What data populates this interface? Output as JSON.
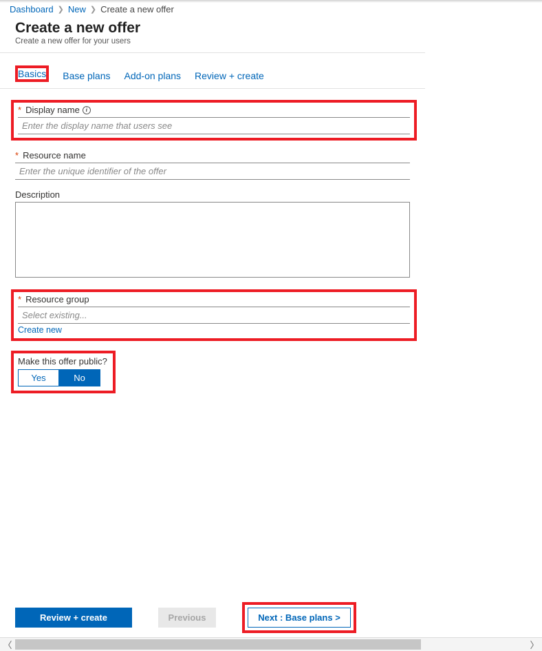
{
  "breadcrumb": {
    "items": [
      {
        "label": "Dashboard",
        "link": true
      },
      {
        "label": "New",
        "link": true
      },
      {
        "label": "Create a new offer",
        "link": false
      }
    ]
  },
  "header": {
    "title": "Create a new offer",
    "subtitle": "Create a new offer for your users"
  },
  "tabs": {
    "items": [
      {
        "label": "Basics",
        "active": true
      },
      {
        "label": "Base plans",
        "active": false
      },
      {
        "label": "Add-on plans",
        "active": false
      },
      {
        "label": "Review + create",
        "active": false
      }
    ]
  },
  "form": {
    "display_name": {
      "label": "Display name",
      "placeholder": "Enter the display name that users see",
      "required": true,
      "info": true
    },
    "resource_name": {
      "label": "Resource name",
      "placeholder": "Enter the unique identifier of the offer",
      "required": true
    },
    "description": {
      "label": "Description",
      "value": ""
    },
    "resource_group": {
      "label": "Resource group",
      "placeholder": "Select existing...",
      "create_link": "Create new",
      "required": true
    },
    "public_toggle": {
      "label": "Make this offer public?",
      "yes": "Yes",
      "no": "No",
      "selected": "No"
    }
  },
  "footer": {
    "review": "Review + create",
    "previous": "Previous",
    "next": "Next : Base plans >"
  },
  "info_glyph": "i"
}
